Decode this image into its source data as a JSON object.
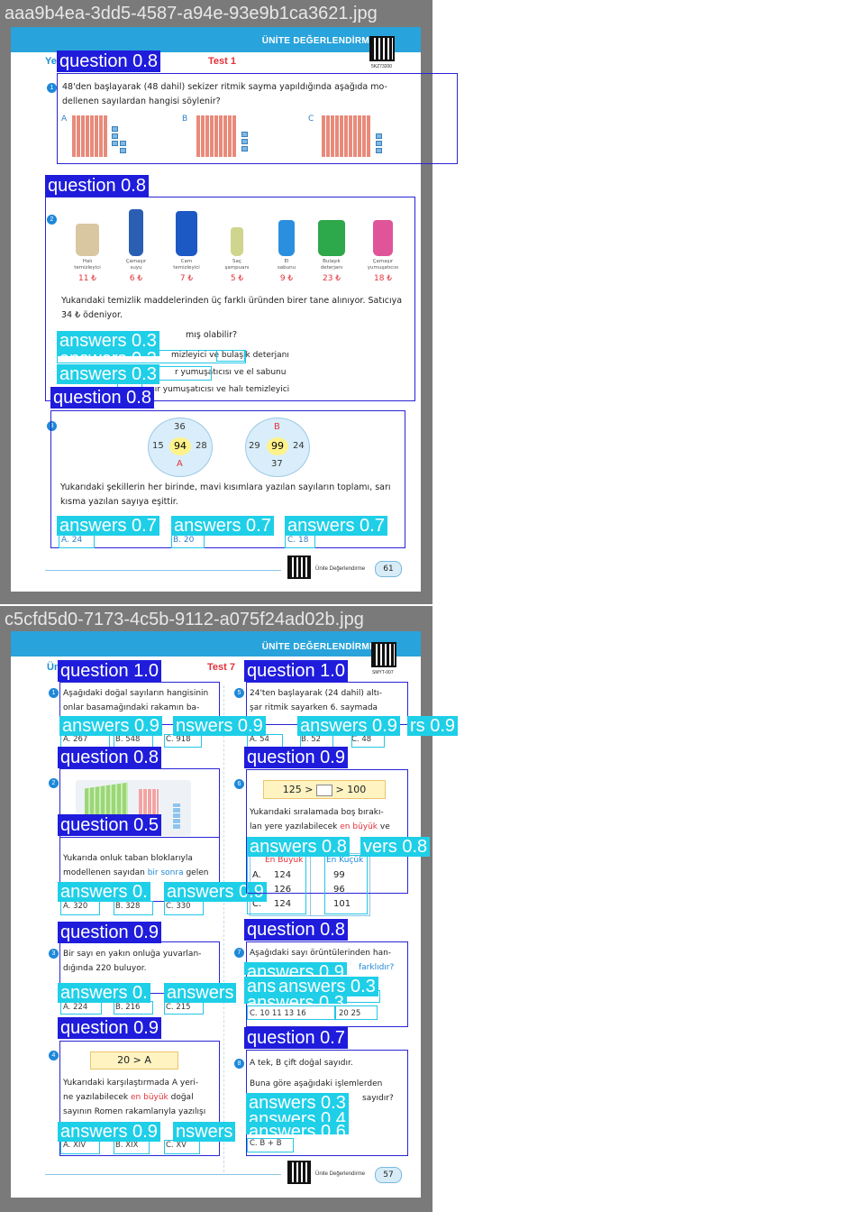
{
  "images": [
    {
      "filename": "aaa9b4ea-3dd5-4587-a94e-93e9b1ca3621.jpg",
      "header_title": "ÜNİTE DEĞERLENDİRME",
      "qr_code_label": "5KZ73200",
      "test_label": "Test 1",
      "left_fragment": "Ye",
      "footer_label": "Ünite Değerlendirme",
      "page_number": "61",
      "q1": {
        "number": "1",
        "text_line1": "48'den başlayarak (48 dahil) sekizer ritmik sayma yapıldığında aşağıda mo-",
        "text_line2": "dellenen sayılardan hangisi söylenir?",
        "option_labels": [
          "A",
          "B",
          "C"
        ]
      },
      "q2": {
        "number": "2",
        "products": [
          {
            "name1": "Halı",
            "name2": "temizleyici",
            "price": "11 ₺",
            "color": "#d9c7a2"
          },
          {
            "name1": "Çamaşır",
            "name2": "suyu",
            "price": "6 ₺",
            "color": "#2a5fb3"
          },
          {
            "name1": "Cam",
            "name2": "temizleyici",
            "price": "7 ₺",
            "color": "#1d59c4"
          },
          {
            "name1": "Saç",
            "name2": "şampuanı",
            "price": "5 ₺",
            "color": "#cfd58c"
          },
          {
            "name1": "El",
            "name2": "sabunu",
            "price": "9 ₺",
            "color": "#2b8fe0"
          },
          {
            "name1": "Bulaşık",
            "name2": "deterjanı",
            "price": "23 ₺",
            "color": "#2da84a"
          },
          {
            "name1": "Çamaşır",
            "name2": "yumuşatıcısı",
            "price": "18 ₺",
            "color": "#e0559a"
          }
        ],
        "text_line1": "Yukarıdaki temizlik maddelerinden üç farklı üründen birer tane alınıyor. Satıcıya",
        "text_line2": "34 ₺ ödeniyor.",
        "question_fragment": "mış olabilir?",
        "opt1_fragment": "mizleyici ve bulaşık deterjanı",
        "opt2_fragment": "r yumuşatıcısı ve el sabunu",
        "opt3_fragment": "şır yumuşatıcısı ve halı temizleyici"
      },
      "q3": {
        "number": "3",
        "wheel1": {
          "top": "36",
          "left": "15",
          "right": "28",
          "center": "94",
          "bottom": "A"
        },
        "wheel2": {
          "top": "B",
          "left": "29",
          "right": "24",
          "center": "99",
          "bottom": "37"
        },
        "text_line1": "Yukarıdaki şekillerin her birinde, mavi kısımlara yazılan sayıların toplamı, sarı",
        "text_line2": "kısma yazılan sayıya eşittir.",
        "options": [
          "A. 24",
          "B. 20",
          "C. 18"
        ]
      },
      "detections": {
        "q1": "question 0.8",
        "q2": "question 0.8",
        "q2_answers": [
          "answers 0.3",
          "answers 0.3",
          "answers 0.3"
        ],
        "q3": "question 0.8",
        "q3_answers": [
          "answers 0.7",
          "answers 0.7",
          "answers 0.7"
        ]
      }
    },
    {
      "filename": "c5cfd5d0-7173-4c5b-9112-a075f24ad02b.jpg",
      "header_title": "ÜNİTE DEĞERLENDİRME",
      "qr_code_label": "SMYT-007",
      "test_label": "Test 7",
      "left_fragment": "Ün",
      "footer_label": "Ünite Değerlendirme",
      "page_number": "57",
      "q1": {
        "number": "1",
        "text_line1": "Aşağıdaki doğal sayıların hangisinin",
        "text_line2": "onlar basamağındaki rakamın ba-",
        "options": [
          "A. 267",
          "B. 548",
          "C. 918"
        ]
      },
      "q2": {
        "number": "2",
        "text_line1": "Yukarıda onluk taban bloklarıyla",
        "text_line2_a": "modellenen sayıdan ",
        "text_line2_b": "bir sonra",
        "text_line2_c": " gelen",
        "options": [
          "A. 320",
          "B. 328",
          "C. 330"
        ]
      },
      "q3": {
        "number": "3",
        "text_line1": "Bir sayı en yakın onluğa yuvarlan-",
        "text_line2": "dığında 220 buluyor.",
        "options": [
          "A. 224",
          "B. 216",
          "C. 215"
        ]
      },
      "q4": {
        "number": "4",
        "banner": "20 > A",
        "text_line1": "Yukarıdaki karşılaştırmada A yeri-",
        "text_line2_a": "ne yazılabilecek ",
        "text_line2_b": "en büyük",
        "text_line2_c": " doğal",
        "text_line3": "sayının Romen rakamlarıyla yazılışı",
        "options": [
          "A. XIV",
          "B. XIX",
          "C. XV"
        ]
      },
      "q5": {
        "number": "5",
        "text_line1": "24'ten başlayarak (24 dahil) altı-",
        "text_line2": "şar ritmik sayarken 6. saymada",
        "options": [
          "A. 54",
          "B. 52",
          "C. 48"
        ]
      },
      "q6": {
        "number": "6",
        "banner_left": "125 >",
        "banner_right": "> 100",
        "text_line1": "Yukarıdaki sıralamada boş bırakı-",
        "text_line2_a": "lan yere yazılabilecek ",
        "text_line2_b": "en büyük",
        "text_line2_c": " ve",
        "col_headers": [
          "En Büyük",
          "En Küçük"
        ],
        "rows": [
          {
            "label": "A.",
            "big": "124",
            "small": "99"
          },
          {
            "label": "B.",
            "big": "126",
            "small": "96"
          },
          {
            "label": "C.",
            "big": "124",
            "small": "101"
          }
        ]
      },
      "q7": {
        "number": "7",
        "text_line1": "Aşağıdaki sayı örüntülerinden han-",
        "text_line2_b": "farklıdır?",
        "opt_c_left": "C. 10  11  13  16",
        "opt_c_right": "20  25"
      },
      "q8": {
        "number": "8",
        "text_line1": "A tek, B çift doğal sayıdır.",
        "text_line2": "Buna göre aşağıdaki işlemlerden",
        "text_line3": "sayıdır?",
        "opt_c": "C. B + B"
      },
      "detections": {
        "q1": "question 1.0",
        "q5": "question 1.0",
        "q1_answers": [
          "answers 0.9",
          "nswers 0.9",
          "answers 0.9",
          "rs 0.9"
        ],
        "q2": "question 0.8",
        "q2_sub": "question 0.5",
        "q2_answers": [
          "answers 0.",
          "answers 0.9"
        ],
        "q6": "question 0.9",
        "q6_answers": [
          "answers 0.8",
          "vers 0.8"
        ],
        "q3": "question 0.9",
        "q3_answers": [
          "answers 0.",
          "answers"
        ],
        "q7": "question 0.8",
        "q7_answers": [
          "answers 0.9",
          "answers 0.3",
          "answers 0.3",
          "ans"
        ],
        "q4": "question 0.9",
        "q4_answers": [
          "answers 0.9",
          "nswers"
        ],
        "q8": "question 0.7",
        "q8_answers": [
          "answers 0.3",
          "answers 0.4",
          "answers 0.6"
        ]
      }
    }
  ]
}
